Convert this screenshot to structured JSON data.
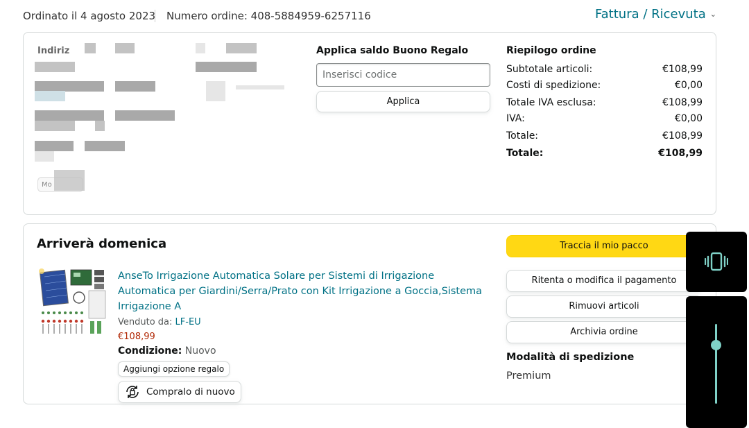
{
  "header": {
    "ordered": "Ordinato il 4 agosto 2023",
    "order_number": "Numero ordine: 408-5884959-6257116",
    "invoice": "Fattura / Ricevuta"
  },
  "address": {
    "label": "Indiriz",
    "tag": "Mo"
  },
  "gift_card": {
    "title": "Applica saldo Buono Regalo",
    "placeholder": "Inserisci codice",
    "apply": "Applica"
  },
  "summary": {
    "title": "Riepilogo ordine",
    "rows": [
      {
        "label": "Subtotale articoli:",
        "value": "€108,99"
      },
      {
        "label": "Costi di spedizione:",
        "value": "€0,00"
      },
      {
        "label": "Totale IVA esclusa:",
        "value": "€108,99"
      },
      {
        "label": "IVA:",
        "value": "€0,00"
      },
      {
        "label": "Totale:",
        "value": "€108,99"
      }
    ],
    "grand_total": {
      "label": "Totale:",
      "value": "€108,99"
    }
  },
  "shipment": {
    "arrival": "Arriverà domenica",
    "product": {
      "title": "AnseTo Irrigazione Automatica Solare per Sistemi di Irrigazione Automatica per Giardini/Serra/Prato con Kit Irrigazione a Goccia,Sistema Irrigazione A",
      "sold_by_label": "Venduto da:",
      "seller": "LF-EU",
      "price": "€108,99",
      "condition_label": "Condizione:",
      "condition": "Nuovo",
      "gift_option": "Aggiungi opzione regalo",
      "buy_again": "Compralo di nuovo"
    },
    "actions": {
      "track": "Traccia il mio pacco",
      "retry_payment": "Ritenta o modifica il pagamento",
      "remove_items": "Rimuovi articoli",
      "archive": "Archivia ordine"
    },
    "shipping_mode_title": "Modalità di spedizione",
    "shipping_mode": "Premium"
  },
  "overlay": {
    "vibrate_icon": "vibrate-icon",
    "volume_level": 0.72,
    "accent": "#7fd1c7"
  }
}
